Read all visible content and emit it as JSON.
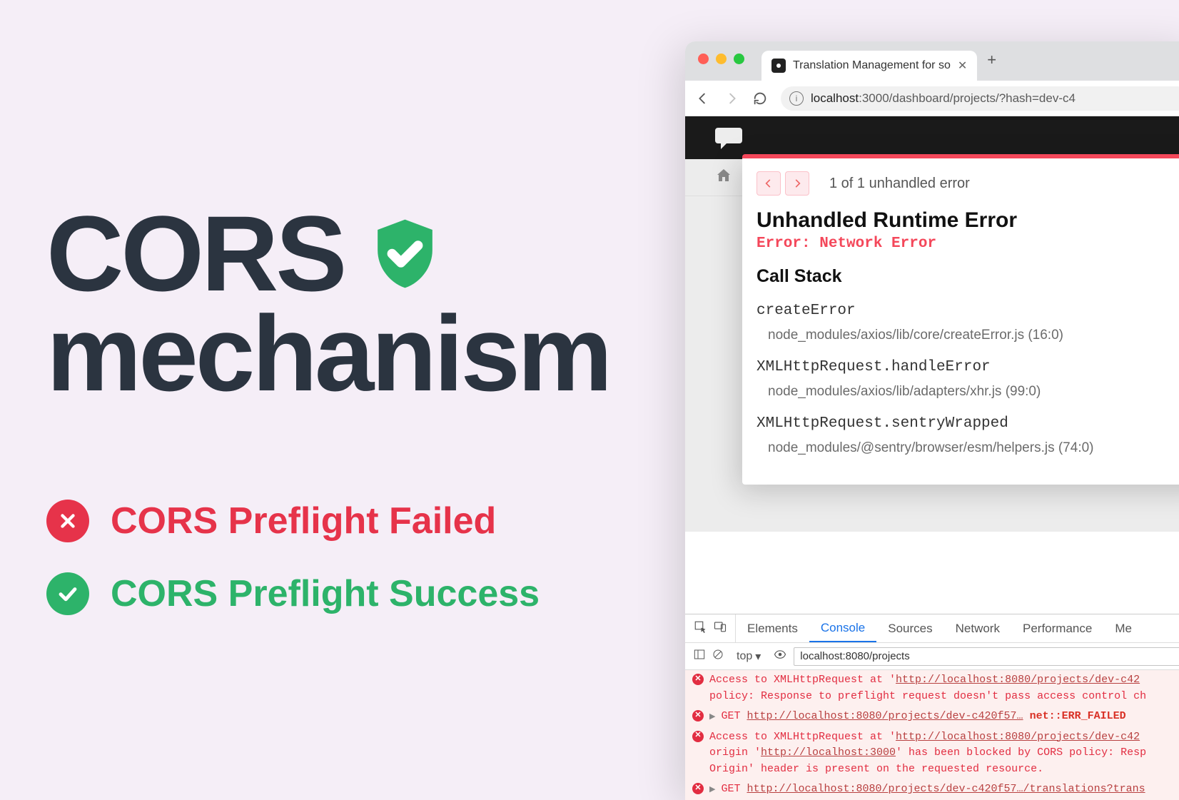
{
  "title": {
    "line1": "CORS",
    "line2": "mechanism"
  },
  "statuses": {
    "failed": "CORS Preflight Failed",
    "success": "CORS Preflight Success"
  },
  "browser": {
    "tab_title": "Translation Management for so",
    "url_host": "localhost",
    "url_path": ":3000/dashboard/projects/?hash=dev-c4"
  },
  "error_overlay": {
    "count_text": "1 of 1 unhandled error",
    "title": "Unhandled Runtime Error",
    "message": "Error: Network Error",
    "stack_title": "Call Stack",
    "frames": [
      {
        "fn": "createError",
        "loc": "node_modules/axios/lib/core/createError.js (16:0)"
      },
      {
        "fn": "XMLHttpRequest.handleError",
        "loc": "node_modules/axios/lib/adapters/xhr.js (99:0)"
      },
      {
        "fn": "XMLHttpRequest.sentryWrapped",
        "loc": "node_modules/@sentry/browser/esm/helpers.js (74:0)"
      }
    ]
  },
  "devtools": {
    "tabs": [
      "Elements",
      "Console",
      "Sources",
      "Network",
      "Performance",
      "Me"
    ],
    "active_tab": "Console",
    "context": "top",
    "filter": "localhost:8080/projects",
    "console": [
      {
        "type": "error",
        "prefix": "Access to XMLHttpRequest at '",
        "url": "http://localhost:8080/projects/dev-c42",
        "suffix": "policy: Response to preflight request doesn't pass access control ch"
      },
      {
        "type": "error",
        "caret": true,
        "method": "GET ",
        "url": "http://localhost:8080/projects/dev-c420f57…",
        "status": " net::ERR_FAILED"
      },
      {
        "type": "error",
        "prefix": "Access to XMLHttpRequest at '",
        "url": "http://localhost:8080/projects/dev-c42",
        "line2a": "origin '",
        "line2url": "http://localhost:3000",
        "line2b": "' has been blocked by CORS policy: Resp",
        "line3": "Origin' header is present on the requested resource."
      },
      {
        "type": "error",
        "caret": true,
        "method": "GET ",
        "url": "http://localhost:8080/projects/dev-c420f57…/translations?trans"
      }
    ]
  }
}
